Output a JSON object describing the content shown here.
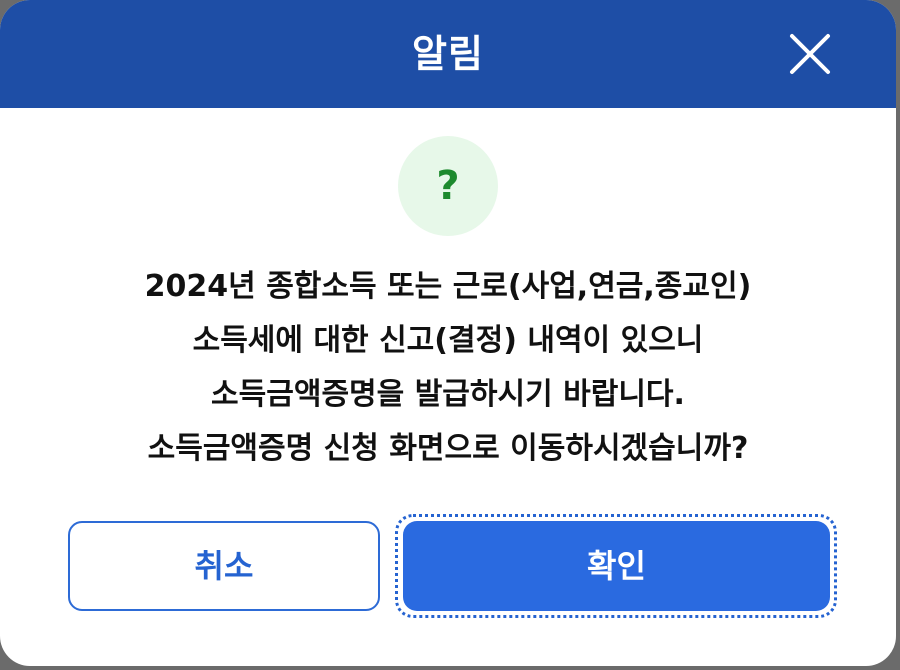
{
  "dialog": {
    "title": "알림",
    "close_icon": "close-icon",
    "status_icon": {
      "name": "question-icon",
      "glyph": "?",
      "color": "#1d8a2e",
      "bg": "#e7f8e9"
    },
    "message_lines": [
      "2024년 종합소득 또는 근로(사업,연금,종교인)",
      "소득세에 대한 신고(결정) 내역이 있으니",
      "소득금액증명을 발급하시기 바랍니다.",
      "소득금액증명 신청 화면으로 이동하시겠습니까?"
    ],
    "buttons": {
      "cancel_label": "취소",
      "confirm_label": "확인"
    },
    "colors": {
      "header": "#1e4ea6",
      "primary": "#2a6ae0"
    }
  }
}
